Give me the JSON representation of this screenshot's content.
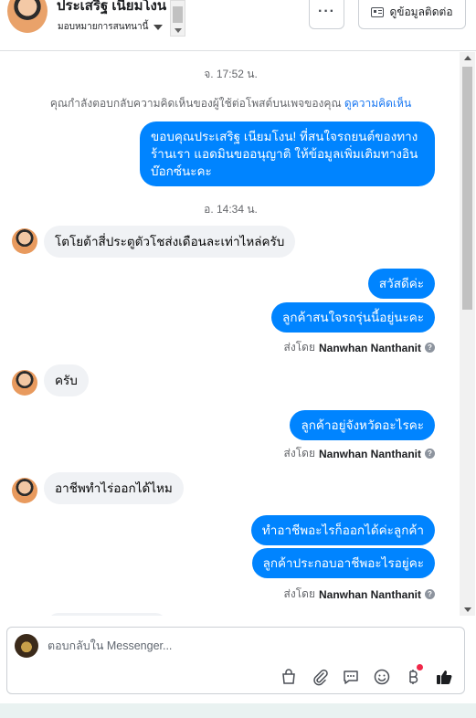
{
  "header": {
    "name": "ประเสริฐ เนียมโงน",
    "assign_label": "มอบหมายการสนทนานี้",
    "more_label": "···",
    "contact_label": "ดูข้อมูลติดต่อ"
  },
  "conversation": {
    "timestamp_1": "จ. 17:52 น.",
    "notice_text": "คุณกำลังตอบกลับความคิดเห็นของผู้ใช้ต่อโพสต์บนเพจของคุณ",
    "notice_link": "ดูความคิดเห็น",
    "out_1_line1": "ขอบคุณประเสริฐ เนียมโงน! ที่สนใจรถยนต์ของทาง",
    "out_1_line2": "ร้านเรา แอดมินขออนุญาติ ให้ข้อมูลเพิ่มเติมทางอิน",
    "out_1_line3": "บ๊อกซ์นะคะ",
    "timestamp_2": "อ. 14:34 น.",
    "in_1": "โตโยต้าสี่ประตูตัวโชส่งเดือนละเท่าไหล่ครับ",
    "out_2": "สวัสดีค่ะ",
    "out_3": "ลูกค้าสนใจรถรุ่นนี้อยู่นะคะ",
    "sent_by_prefix": "ส่งโดย",
    "sender_name": "Nanwhan Nanthanit",
    "in_2": "ครับ",
    "out_4": "ลูกค้าอยู่จังหวัดอะไรคะ",
    "in_3": "อาชีพทำไร่ออกได้ไหม",
    "out_5": "ทำอาชีพอะไรก็ออกได้ค่ะลูกค้า",
    "out_6": "ลูกค้าประกอบอาชีพอะไรอยู่คะ"
  },
  "composer": {
    "placeholder": "ตอบกลับใน Messenger..."
  },
  "icons": {
    "tools": [
      "shopping-bag-icon",
      "paperclip-icon",
      "saved-reply-icon",
      "emoji-icon",
      "currency-icon",
      "thumbs-up-icon"
    ]
  },
  "colors": {
    "outgoing_bubble": "#0084ff",
    "incoming_bubble": "#f0f2f5",
    "link": "#1877f2",
    "like": "#1c1e21"
  }
}
